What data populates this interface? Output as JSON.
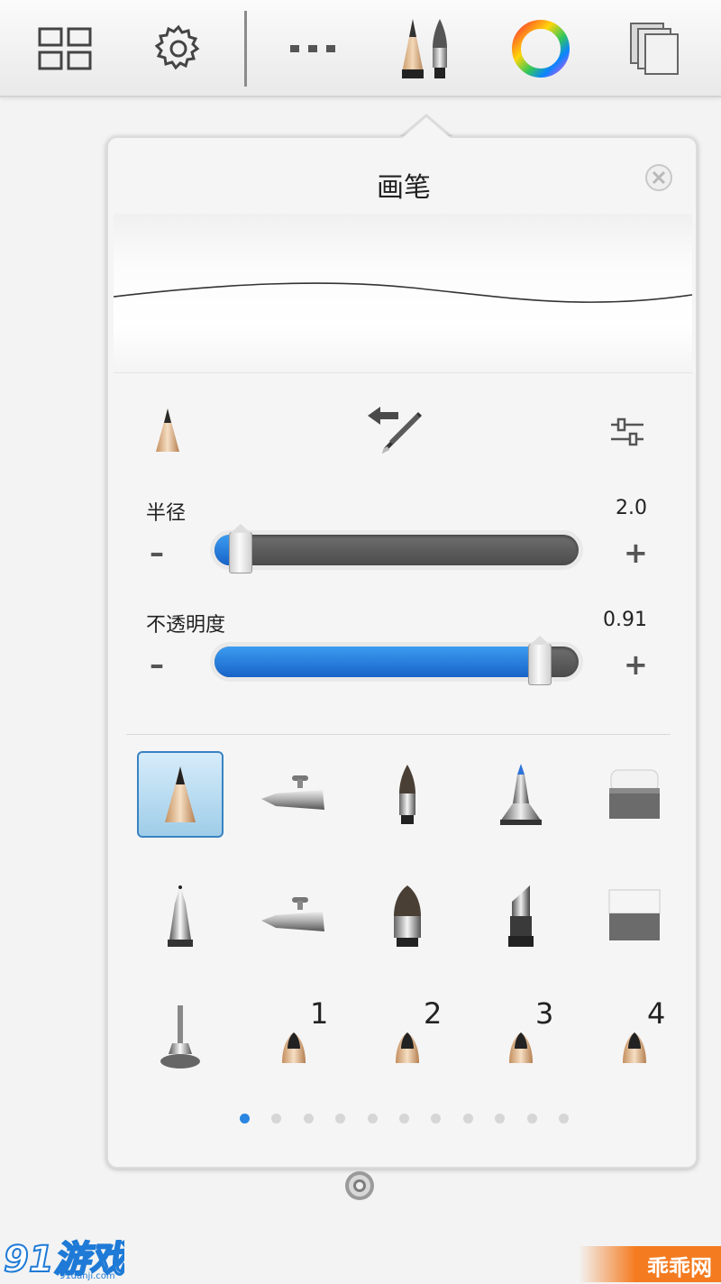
{
  "toolbar": {
    "items": [
      "grid-icon",
      "gear-icon",
      "more-icon",
      "brushes-icon",
      "color-wheel-icon",
      "layers-icon"
    ]
  },
  "panel": {
    "title": "画笔",
    "close_icon": "close-icon"
  },
  "tools_row": {
    "left_icon": "pencil-tip-icon",
    "center_icon": "swap-pen-icon",
    "right_icon": "settings-sliders-icon"
  },
  "radius": {
    "label": "半径",
    "value_text": "2.0",
    "value": 0.07,
    "minus": "–",
    "plus": "+"
  },
  "opacity": {
    "label": "不透明度",
    "value_text": "0.91",
    "value": 0.89,
    "minus": "–",
    "plus": "+"
  },
  "brushes": {
    "row1": [
      "pencil",
      "airbrush",
      "paint-brush",
      "marker",
      "eraser"
    ],
    "row2": [
      "ballpoint-pen",
      "airbrush-2",
      "wide-brush",
      "chisel-marker",
      "hard-eraser"
    ],
    "row3": [
      "smudge",
      "custom-1",
      "custom-2",
      "custom-3",
      "custom-4"
    ],
    "custom_labels": [
      "1",
      "2",
      "3",
      "4"
    ]
  },
  "pagination": {
    "count": 11,
    "active": 0
  },
  "watermarks": {
    "left_text": "91游戏",
    "left_sub": "91danji.com",
    "right_text": "乖乖网"
  },
  "colors": {
    "accent": "#2a86e0",
    "fill_blue": "#1f75d6",
    "track_dark": "#5a5a5a"
  }
}
